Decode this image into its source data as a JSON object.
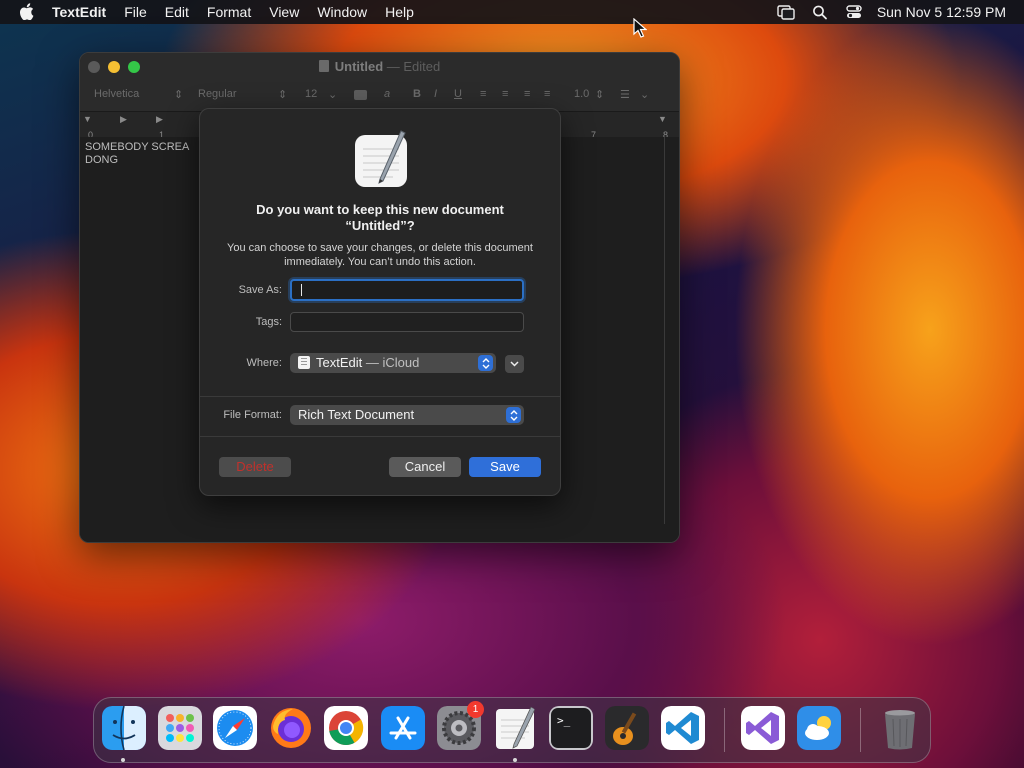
{
  "menubar": {
    "app_name": "TextEdit",
    "items": [
      "File",
      "Edit",
      "Format",
      "View",
      "Window",
      "Help"
    ],
    "clock": "Sun Nov 5  12:59 PM"
  },
  "window": {
    "title": "Untitled",
    "title_suffix": "— Edited",
    "toolbar": {
      "font_family": "Helvetica",
      "font_style": "Regular",
      "font_size": "12",
      "bold": "B",
      "italic": "I",
      "underline": "U",
      "line_spacing": "1.0"
    },
    "ruler_marks": [
      "0",
      "1",
      "7",
      "8"
    ],
    "document_text": "SOMEBODY SCREA\nDONG"
  },
  "dialog": {
    "title": "Do you want to keep this new document “Untitled”?",
    "message": "You can choose to save your changes, or delete this document immediately. You can’t undo this action.",
    "save_as_label": "Save As:",
    "save_as_value": "",
    "tags_label": "Tags:",
    "where_label": "Where:",
    "where_value": "TextEdit",
    "where_suffix": "— iCloud",
    "file_format_label": "File Format:",
    "file_format_value": "Rich Text Document",
    "delete_label": "Delete",
    "cancel_label": "Cancel",
    "save_label": "Save"
  },
  "dock": {
    "apps": [
      "finder-icon",
      "launchpad-icon",
      "safari-icon",
      "firefox-icon",
      "chrome-icon",
      "app-store-icon",
      "system-settings-icon",
      "textedit-icon",
      "terminal-icon",
      "garageband-icon",
      "vscode-icon",
      "visual-studio-icon",
      "weather-icon",
      "trash-icon"
    ],
    "settings_badge": "1"
  },
  "colors": {
    "accent": "#2f6fd9",
    "delete_text": "#c0312c",
    "badge": "#f2392e"
  }
}
